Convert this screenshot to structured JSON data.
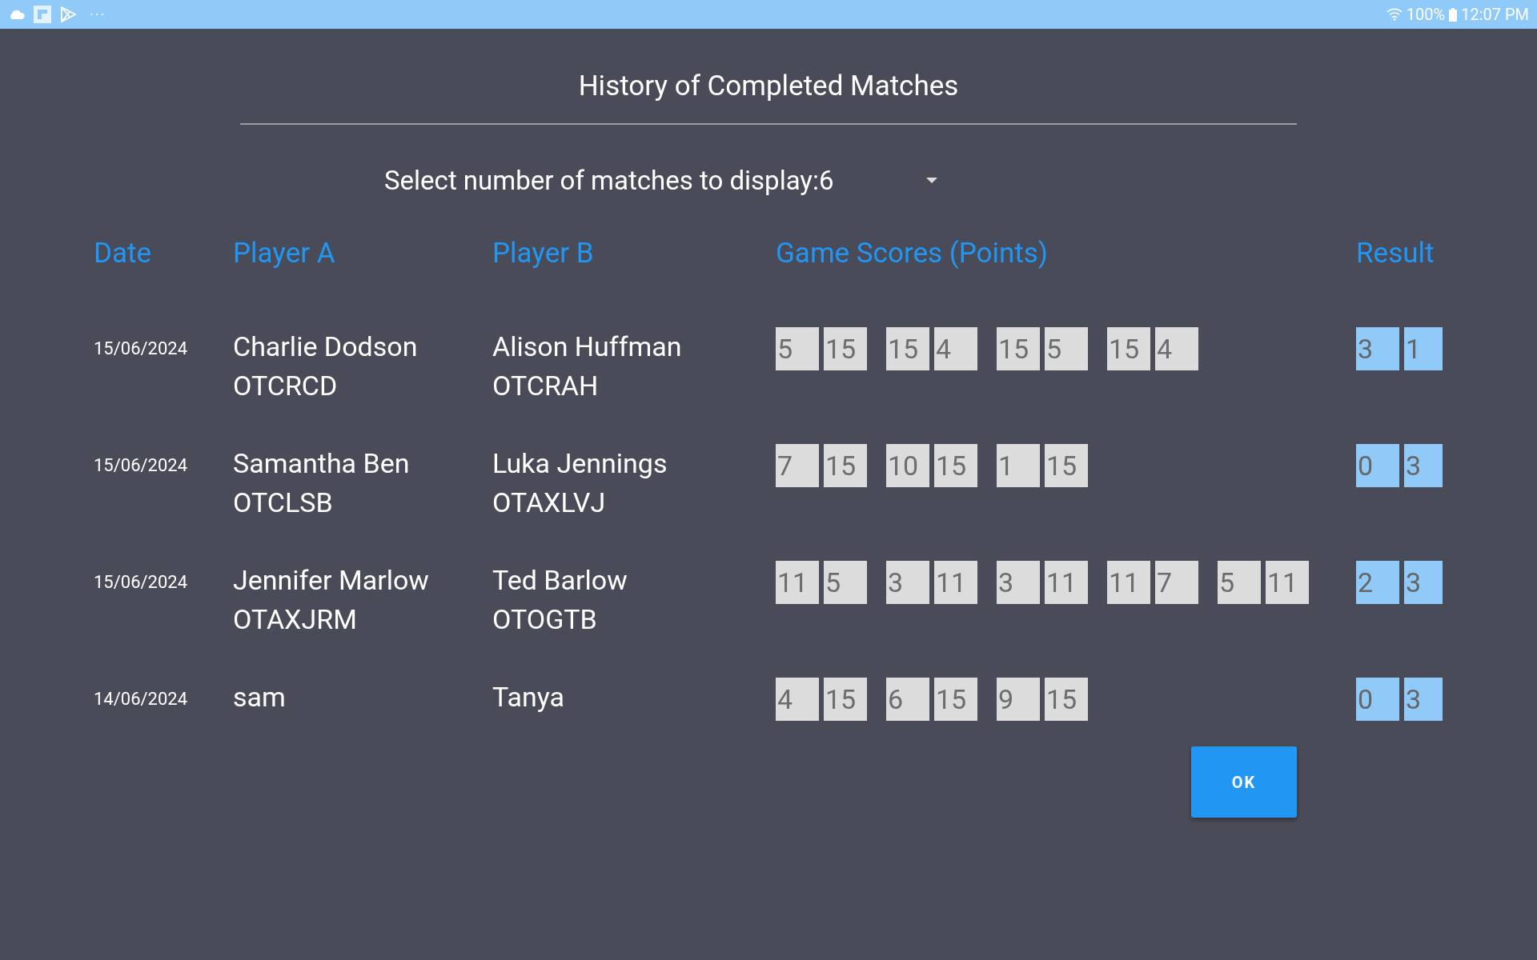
{
  "status_bar": {
    "battery": "100%",
    "time": "12:07 PM",
    "more": "···"
  },
  "dialog": {
    "title": "History of Completed Matches",
    "selector": "Select number of matches to display:6",
    "columns": [
      "Date",
      "Player A",
      "Player B",
      "Game Scores (Points)",
      "Result"
    ],
    "rows": [
      {
        "date": "15/06/2024",
        "player_a": {
          "name": "Charlie Dodson",
          "code": "OTCRCD"
        },
        "player_b": {
          "name": "Alison Huffman",
          "code": "OTCRAH"
        },
        "games": [
          [
            "5",
            "15"
          ],
          [
            "15",
            "4"
          ],
          [
            "15",
            "5"
          ],
          [
            "15",
            "4"
          ]
        ],
        "result": [
          "3",
          "1"
        ]
      },
      {
        "date": "15/06/2024",
        "player_a": {
          "name": "Samantha Ben",
          "code": "OTCLSB"
        },
        "player_b": {
          "name": "Luka Jennings",
          "code": "OTAXLVJ"
        },
        "games": [
          [
            "7",
            "15"
          ],
          [
            "10",
            "15"
          ],
          [
            "1",
            "15"
          ]
        ],
        "result": [
          "0",
          "3"
        ]
      },
      {
        "date": "15/06/2024",
        "player_a": {
          "name": "Jennifer Marlow",
          "code": "OTAXJRM"
        },
        "player_b": {
          "name": "Ted Barlow",
          "code": "OTOGTB"
        },
        "games": [
          [
            "11",
            "5"
          ],
          [
            "3",
            "11"
          ],
          [
            "3",
            "11"
          ],
          [
            "11",
            "7"
          ],
          [
            "5",
            "11"
          ]
        ],
        "result": [
          "2",
          "3"
        ]
      },
      {
        "date": "14/06/2024",
        "player_a": {
          "name": "sam"
        },
        "player_b": {
          "name": "Tanya"
        },
        "games": [
          [
            "4",
            "15"
          ],
          [
            "6",
            "15"
          ],
          [
            "9",
            "15"
          ]
        ],
        "result": [
          "0",
          "3"
        ]
      }
    ],
    "ok_button": "OK"
  }
}
